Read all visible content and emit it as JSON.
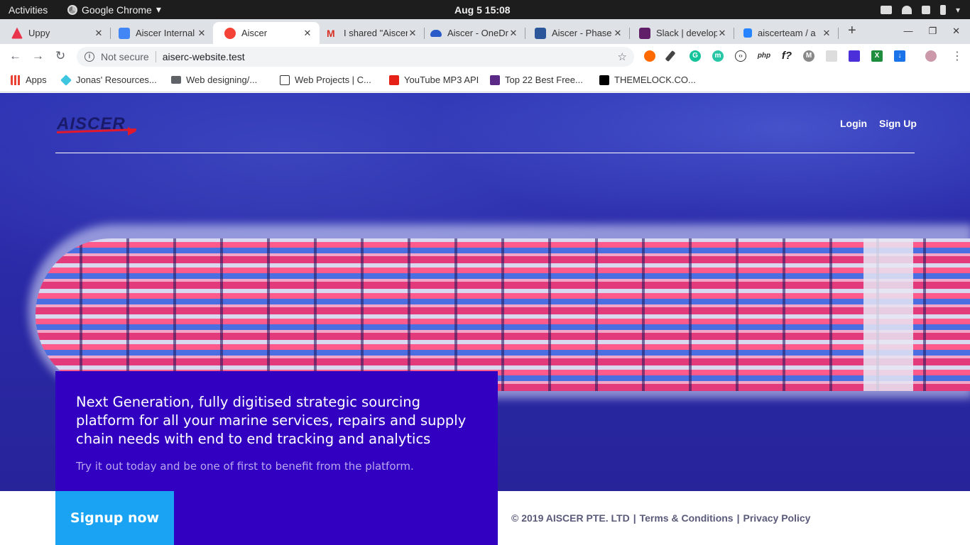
{
  "os": {
    "activities": "Activities",
    "app_name": "Google Chrome",
    "clock": "Aug 5  15:08"
  },
  "tabs": [
    {
      "title": "Uppy",
      "color": "#e8334a"
    },
    {
      "title": "Aiscer Internal",
      "color": "#4285f4"
    },
    {
      "title": "Aiscer",
      "color": "#f44336",
      "active": true
    },
    {
      "title": "I shared \"Aiscer",
      "color": "#d93025"
    },
    {
      "title": "Aiscer - OneDrive",
      "color": "#2a5cc9"
    },
    {
      "title": "Aiscer - Phase",
      "color": "#2b579a"
    },
    {
      "title": "Slack | develop",
      "color": "#611f69"
    },
    {
      "title": "aiscerteam / a",
      "color": "#2684ff"
    }
  ],
  "omnibox": {
    "security_label": "Not secure",
    "url": "aiserc-website.test"
  },
  "bookmarks": [
    {
      "label": "Apps",
      "color": "#e94235"
    },
    {
      "label": "Jonas' Resources...",
      "color": "#3ec6e0"
    },
    {
      "label": "Web designing/...",
      "color": "#5f6368"
    },
    {
      "label": "Web Projects | C...",
      "color": "#333333"
    },
    {
      "label": "YouTube MP3 API",
      "color": "#e62117"
    },
    {
      "label": "Top 22 Best Free...",
      "color": "#5b2a86"
    },
    {
      "label": "THEMELOCK.CO...",
      "color": "#000000"
    }
  ],
  "site": {
    "logo_text": "AISCER",
    "nav": {
      "login": "Login",
      "signup": "Sign Up"
    },
    "headline": "Next Generation, fully digitised strategic sourcing platform for all your marine services, repairs and supply chain needs with end to end tracking and analytics",
    "subline": "Try it out today and be one of first to benefit from the platform.",
    "cta": "Signup now",
    "footer": {
      "copyright": "© 2019 AISCER PTE. LTD",
      "terms": "Terms & Conditions",
      "privacy": "Privacy Policy",
      "separator": "|"
    },
    "colors": {
      "promo_bg": "#3200c0",
      "cta_bg": "#1aa3f2"
    }
  }
}
